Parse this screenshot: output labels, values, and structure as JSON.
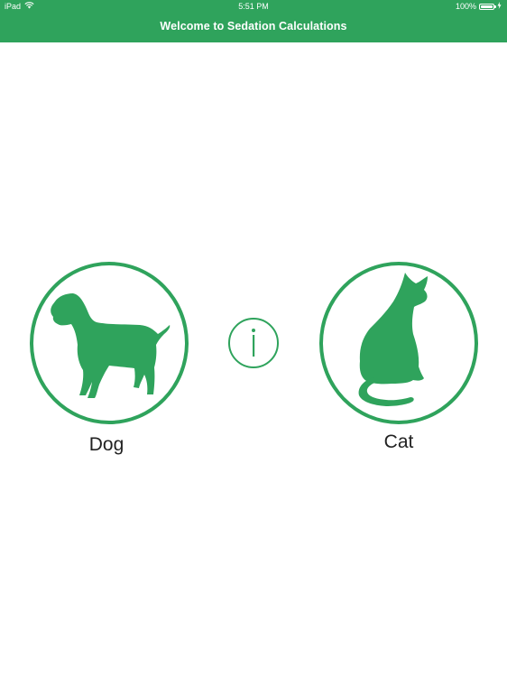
{
  "status_bar": {
    "device": "iPad",
    "time": "5:51 PM",
    "battery_percent": "100%",
    "battery_level": 1.0
  },
  "header": {
    "title": "Welcome to Sedation Calculations"
  },
  "animals": {
    "dog": {
      "label": "Dog",
      "icon": "dog-icon"
    },
    "cat": {
      "label": "Cat",
      "icon": "cat-icon"
    }
  },
  "info": {
    "icon": "info-icon"
  },
  "colors": {
    "accent": "#2fa35c",
    "background": "#ffffff",
    "label_text": "#222222"
  }
}
